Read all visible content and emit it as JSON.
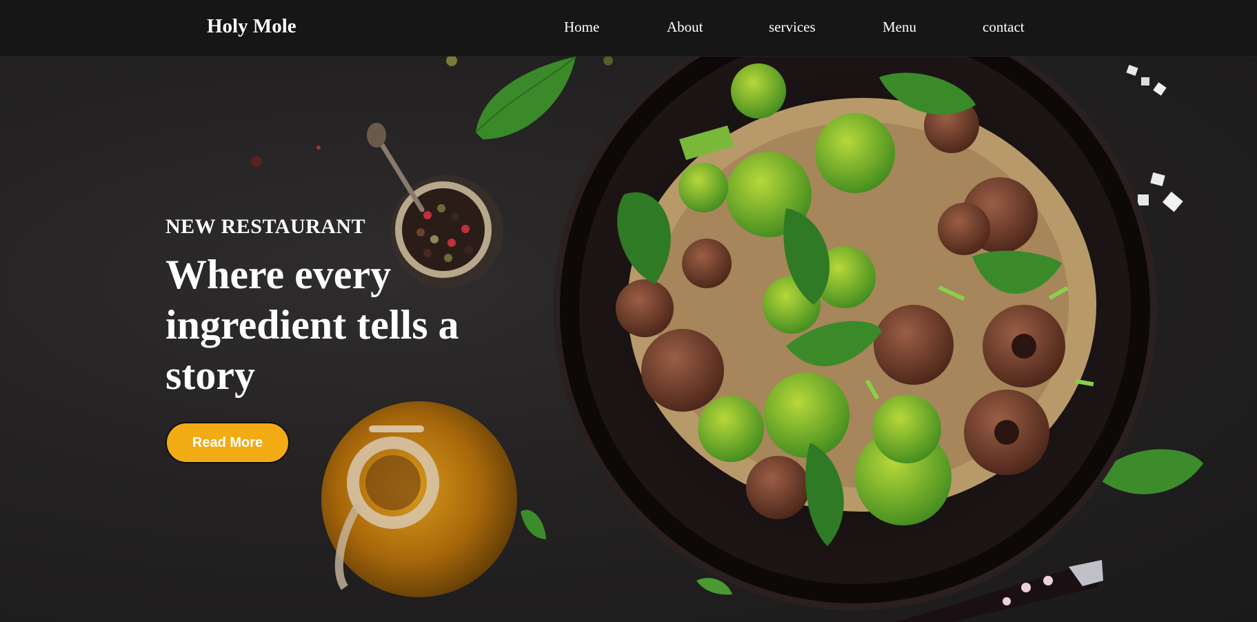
{
  "nav": {
    "brand": "Holy Mole",
    "links": [
      "Home",
      "About",
      "services",
      "Menu",
      "contact"
    ]
  },
  "hero": {
    "eyebrow": "NEW RESTAURANT",
    "headline": "Where every ingredient tells a story",
    "cta_label": "Read More"
  },
  "colors": {
    "nav_background": "#161616",
    "accent": "#f2ab14",
    "text": "#ffffff"
  },
  "icons": [
    "food-bowl-image",
    "pepper-jar-image",
    "oil-jug-image",
    "basil-leaf-image"
  ]
}
